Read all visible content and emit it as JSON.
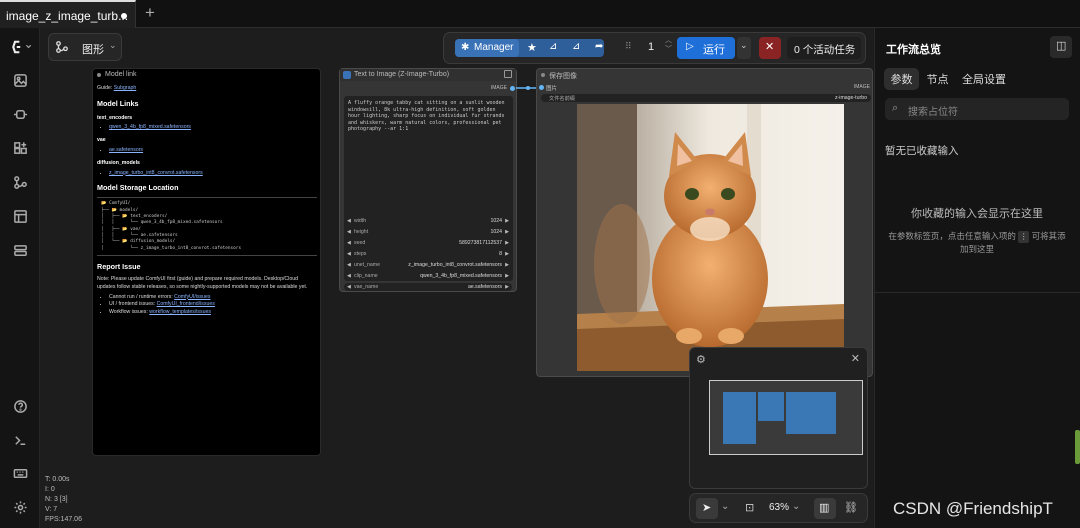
{
  "tab": {
    "title": "image_z_image_turb..."
  },
  "graph_button": {
    "label": "图形"
  },
  "toolbar": {
    "manager_label": "Manager",
    "run_count": "1",
    "run_label": "运行",
    "active_tasks": "0 个活动任务"
  },
  "node_model_link": {
    "title": "Model link",
    "guide_label": "Guide:",
    "guide_link": "Subgraph",
    "h_links": "Model Links",
    "sec_text_encoders": "text_encoders",
    "file_text_encoder": "qwen_3_4b_fp8_mixed.safetensors",
    "sec_vae": "vae",
    "file_vae": "ae.safetensors",
    "sec_diffusion": "diffusion_models",
    "file_diffusion": "z_image_turbo_int8_convrot.safetensors",
    "h_storage": "Model Storage Location",
    "tree": "📂 ComfyUI/\n├── 📂 models/\n│   ├── 📂 text_encoders/\n│   │      └── qwen_3_4b_fp8_mixed.safetensors\n│   ├── 📂 vae/\n│   │      └── ae.safetensors\n│   └── 📂 diffusion_models/\n│          └── z_image_turbo_int8_convrot.safetensors",
    "h_report": "Report Issue",
    "note": "Note: Please update ComfyUI first (guide) and prepare required models. Desktop/Cloud updates follow stable releases, so some nightly-supported models may not be available yet.",
    "issue1_label": "Cannot run / runtime errors:",
    "issue1_link": "ComfyUI/issues",
    "issue2_label": "UI / frontend issues:",
    "issue2_link": "ComfyUI_frontend/issues",
    "issue3_label": "Workflow issues:",
    "issue3_link": "workflow_templates/issues"
  },
  "node_t2i": {
    "title": "Text to Image (Z-Image-Turbo)",
    "output": "IMAGE",
    "prompt": "A fluffy orange tabby cat sitting on a sunlit wooden windowsill, 8k ultra-high definition, soft golden hour lighting, sharp focus on individual fur strands and whiskers, warm natural colors, professional pet photography --ar 1:1",
    "widgets": [
      {
        "name": "width",
        "value": "1024"
      },
      {
        "name": "height",
        "value": "1024"
      },
      {
        "name": "seed",
        "value": "589273817112537"
      },
      {
        "name": "steps",
        "value": "8"
      },
      {
        "name": "unet_name",
        "value": "z_image_turbo_int8_convrot.safetensors"
      },
      {
        "name": "clip_name",
        "value": "qwen_3_4b_fp8_mixed.safetensors"
      },
      {
        "name": "vae_name",
        "value": "ae.safetensors"
      }
    ]
  },
  "node_save": {
    "title": "保存图像",
    "input": "图片",
    "prefix_label": "文件名前缀",
    "prefix_value": "z-image-turbo",
    "out_label": "IMAGE"
  },
  "minimap": {},
  "bottom": {
    "zoom": "63%"
  },
  "stats": [
    "T: 0.00s",
    "I: 0",
    "N: 3 [3]",
    "V: 7",
    "FPS:147.06"
  ],
  "right_panel": {
    "title": "工作流总览",
    "tabs": [
      "参数",
      "节点",
      "全局设置"
    ],
    "search_placeholder": "搜索占位符",
    "empty_title": "暂无已收藏输入",
    "placeholder_title": "你收藏的输入会显示在这里",
    "hint_a": "在参数标签页，点击任意输入项的",
    "hint_b": "可将其添",
    "hint_c": "加到这里"
  },
  "watermark": "CSDN @FriendshipT",
  "colors": {
    "accent": "#1f6fd8",
    "manager": "#3a72b8",
    "stop": "#8a2424",
    "minimap_node": "#3a78b5"
  }
}
